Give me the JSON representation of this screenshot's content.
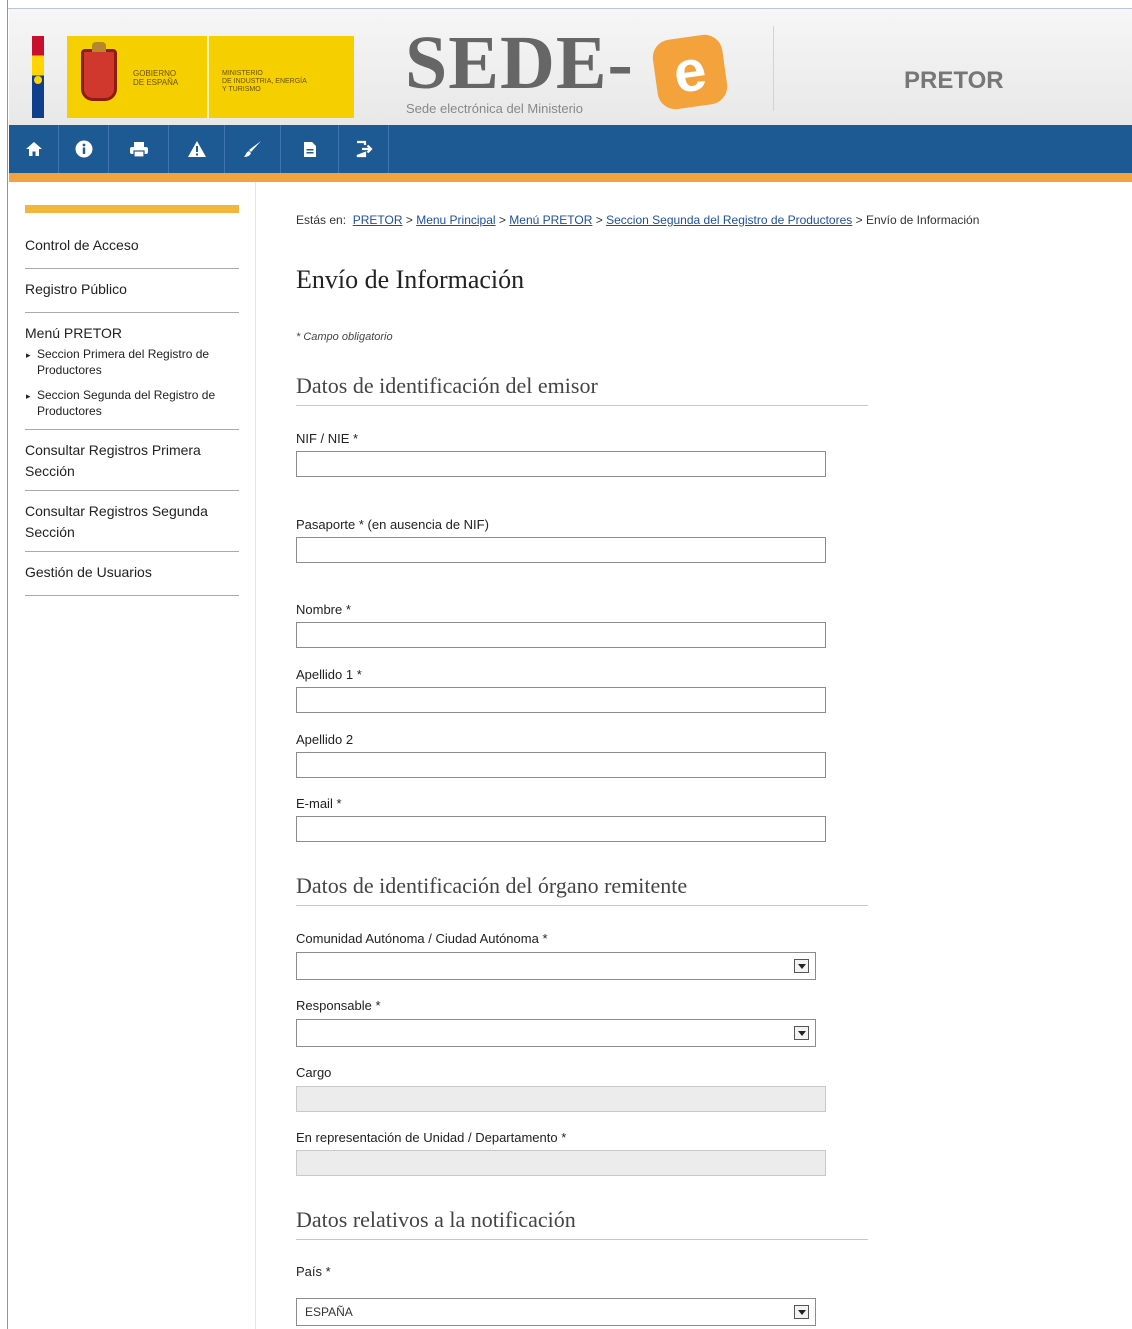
{
  "header": {
    "gov_text": "GOBIERNO\nDE ESPAÑA",
    "ministry_text": "MINISTERIO\nDE INDUSTRIA, ENERGÍA\nY TURISMO",
    "logo_text": "SEDE-",
    "logo_e": "e",
    "logo_subtitle": "Sede electrónica del Ministerio",
    "app_name": "PRETOR"
  },
  "navbar": {
    "icons": [
      "home-icon",
      "info-icon",
      "print-icon",
      "warning-icon",
      "edit-icon",
      "document-icon",
      "logout-icon"
    ]
  },
  "sidebar": {
    "items": [
      {
        "label": "Control de Acceso"
      },
      {
        "label": "Registro Público"
      },
      {
        "label": "Menú PRETOR",
        "subitems": [
          "Seccion Primera del Registro de Productores",
          "Seccion Segunda del Registro de Productores"
        ]
      },
      {
        "label": "Consultar Registros Primera Sección"
      },
      {
        "label": "Consultar Registros Segunda Sección"
      },
      {
        "label": "Gestión de Usuarios"
      }
    ]
  },
  "breadcrumb": {
    "prefix": "Estás en:",
    "links": [
      "PRETOR",
      "Menu Principal",
      "Menú PRETOR",
      "Seccion Segunda del Registro de Productores"
    ],
    "separator": ">",
    "current": "Envío de Información"
  },
  "page": {
    "title": "Envío de Información",
    "required_note": "* Campo obligatorio"
  },
  "sections": {
    "emisor": {
      "heading": "Datos de identificación del emisor",
      "nif_label": "NIF / NIE *",
      "nif_value": "",
      "pasaporte_label": "Pasaporte * (en ausencia de NIF)",
      "pasaporte_value": "",
      "nombre_label": "Nombre *",
      "nombre_value": "",
      "apellido1_label": "Apellido 1 *",
      "apellido1_value": "",
      "apellido2_label": "Apellido 2",
      "apellido2_value": "",
      "email_label": "E-mail *",
      "email_value": ""
    },
    "organo": {
      "heading": "Datos de identificación del órgano remitente",
      "comunidad_label": "Comunidad Autónoma / Ciudad Autónoma *",
      "comunidad_value": "",
      "responsable_label": "Responsable *",
      "responsable_value": "",
      "cargo_label": "Cargo",
      "cargo_value": "",
      "representacion_label": "En representación de Unidad / Departamento *",
      "representacion_value": ""
    },
    "notificacion": {
      "heading": "Datos relativos a la notificación",
      "pais_label": "País *",
      "pais_value": "ESPAÑA"
    }
  },
  "colors": {
    "navbar": "#1d5a94",
    "accent": "#f2a340",
    "gov_yellow": "#f5cf00",
    "link": "#1f4e9c"
  }
}
